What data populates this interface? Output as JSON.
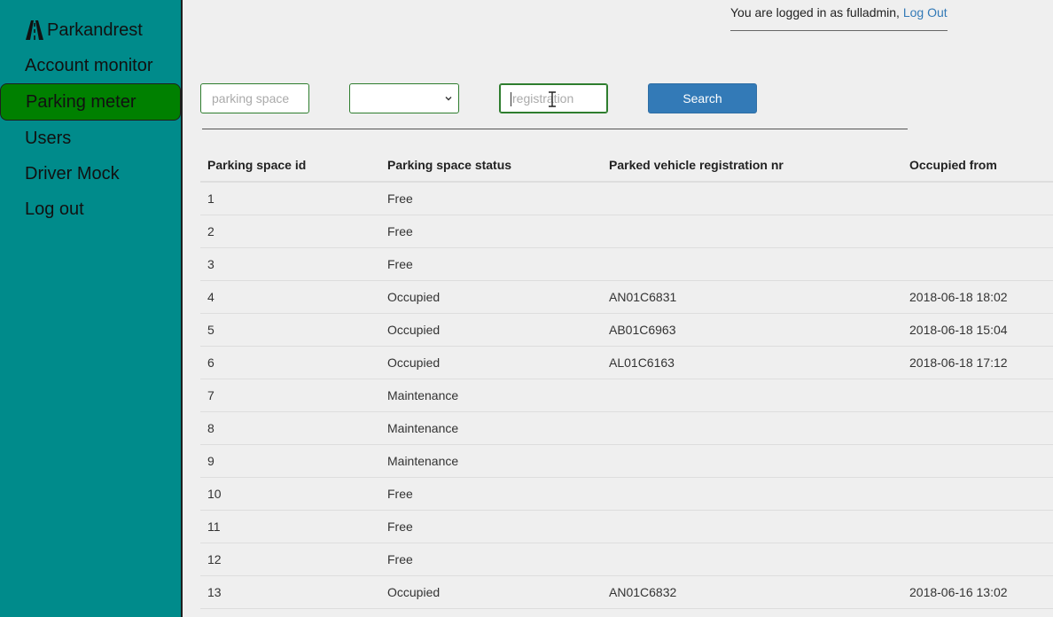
{
  "sidebar": {
    "brand": "Parkandrest",
    "brand_icon": "road-icon",
    "items": [
      {
        "label": "Account monitor",
        "active": false
      },
      {
        "label": "Parking meter",
        "active": true
      },
      {
        "label": "Users",
        "active": false
      },
      {
        "label": "Driver Mock",
        "active": false
      },
      {
        "label": "Log out",
        "active": false
      }
    ]
  },
  "header": {
    "login_text": "You are logged in as fulladmin,",
    "logout_link": "Log Out"
  },
  "filters": {
    "parking_space_placeholder": "parking space",
    "status_select_value": "",
    "registration_placeholder": "registration",
    "search_label": "Search"
  },
  "colors": {
    "sidebar_bg": "#008b8b",
    "active_item_bg": "#008000",
    "button_bg": "#337ab7",
    "link": "#337ab7"
  },
  "table": {
    "columns": [
      "Parking space id",
      "Parking space status",
      "Parked vehicle registration nr",
      "Occupied from"
    ],
    "rows": [
      [
        "1",
        "Free",
        "",
        ""
      ],
      [
        "2",
        "Free",
        "",
        ""
      ],
      [
        "3",
        "Free",
        "",
        ""
      ],
      [
        "4",
        "Occupied",
        "AN01C6831",
        "2018-06-18 18:02"
      ],
      [
        "5",
        "Occupied",
        "AB01C6963",
        "2018-06-18 15:04"
      ],
      [
        "6",
        "Occupied",
        "AL01C6163",
        "2018-06-18 17:12"
      ],
      [
        "7",
        "Maintenance",
        "",
        ""
      ],
      [
        "8",
        "Maintenance",
        "",
        ""
      ],
      [
        "9",
        "Maintenance",
        "",
        ""
      ],
      [
        "10",
        "Free",
        "",
        ""
      ],
      [
        "11",
        "Free",
        "",
        ""
      ],
      [
        "12",
        "Free",
        "",
        ""
      ],
      [
        "13",
        "Occupied",
        "AN01C6832",
        "2018-06-16 13:02"
      ]
    ]
  }
}
